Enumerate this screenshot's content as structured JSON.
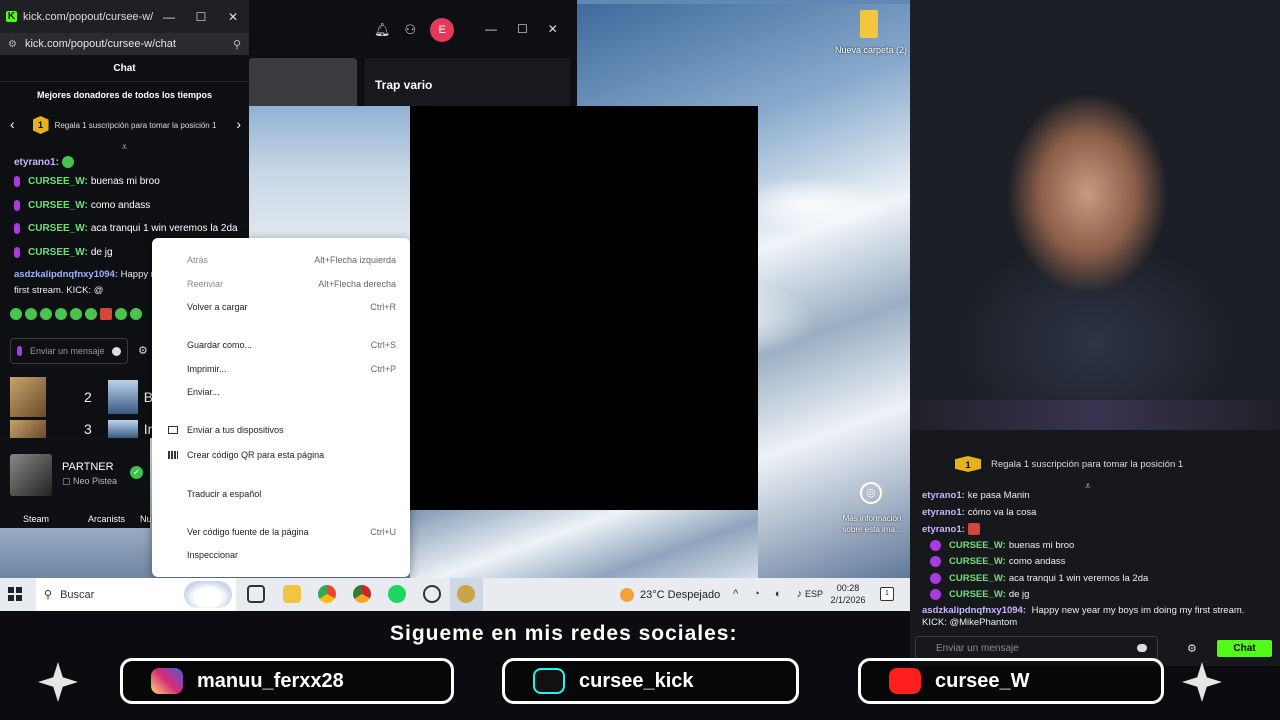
{
  "chat_window": {
    "title": "kick.com/popout/cursee-w/chat...",
    "url": "kick.com/popout/cursee-w/chat",
    "min": "—",
    "max": "☐",
    "close": "✕",
    "header": "Chat",
    "donors_title": "Mejores donadores de todos los tiempos",
    "gift_badge": "1",
    "gift_text": "Regala 1 suscripción para tomar la posición 1",
    "messages": [
      {
        "user": "etyrano1:",
        "text": ""
      },
      {
        "user": "CURSEE_W:",
        "text": "buenas mi broo"
      },
      {
        "user": "CURSEE_W:",
        "text": "como andass"
      },
      {
        "user": "CURSEE_W:",
        "text": "aca tranqui 1 win veremos la 2da"
      },
      {
        "user": "CURSEE_W:",
        "text": "de jg"
      }
    ],
    "long_message_user": "asdzkalipdnqfnxy1094:",
    "long_message_text": "Happy n... im doing my first stream. KICK: @",
    "input_placeholder": "Enviar un mensaje",
    "leaderboard": [
      {
        "rank": "2",
        "name": "B"
      },
      {
        "rank": "3",
        "name": "In"
      }
    ]
  },
  "partner": {
    "name": "PARTNER",
    "sub": "Neo Pistea"
  },
  "desktop_labels": [
    "Steam",
    "Arcanists",
    "Nu"
  ],
  "app": {
    "avatar_letter": "E",
    "card_title": "Trap vario",
    "min": "—",
    "max": "☐",
    "close": "✕"
  },
  "desktop": {
    "folder_label": "Nueva carpeta (2)",
    "info_label": "Más información sobre esta ima..."
  },
  "context_menu": {
    "items": [
      {
        "label": "Atrás",
        "shortcut": "Alt+Flecha izquierda",
        "disabled": true
      },
      {
        "label": "Reenviar",
        "shortcut": "Alt+Flecha derecha",
        "disabled": true
      },
      {
        "label": "Volver a cargar",
        "shortcut": "Ctrl+R",
        "disabled": false
      },
      {
        "label": "Guardar como...",
        "shortcut": "Ctrl+S",
        "disabled": false
      },
      {
        "label": "Imprimir...",
        "shortcut": "Ctrl+P",
        "disabled": false
      },
      {
        "label": "Enviar...",
        "shortcut": "",
        "disabled": false
      },
      {
        "label": "Enviar a tus dispositivos",
        "shortcut": "",
        "disabled": false
      },
      {
        "label": "Crear código QR para esta página",
        "shortcut": "",
        "disabled": false
      },
      {
        "label": "Traducir a español",
        "shortcut": "",
        "disabled": false
      },
      {
        "label": "Ver código fuente de la página",
        "shortcut": "Ctrl+U",
        "disabled": false
      },
      {
        "label": "Inspeccionar",
        "shortcut": "",
        "disabled": false
      }
    ]
  },
  "taskbar": {
    "search_label": "Buscar",
    "weather": "23°C  Despejado",
    "language": "ESP",
    "time": "00:28",
    "date": "2/1/2026",
    "notif_count": "1"
  },
  "stream_chat": {
    "gift_badge": "1",
    "gift_text": "Regala 1 suscripción para tomar la posición 1",
    "messages": [
      {
        "user": "etyrano1:",
        "text": "ke pasa Manin",
        "badge": false
      },
      {
        "user": "etyrano1:",
        "text": "cómo va la cosa",
        "badge": false
      },
      {
        "user": "etyrano1:",
        "text": "",
        "badge": false
      },
      {
        "user": "CURSEE_W:",
        "text": "buenas mi broo",
        "badge": true
      },
      {
        "user": "CURSEE_W:",
        "text": "como andass",
        "badge": true
      },
      {
        "user": "CURSEE_W:",
        "text": "aca tranqui 1 win veremos la 2da",
        "badge": true
      },
      {
        "user": "CURSEE_W:",
        "text": "de jg",
        "badge": true
      }
    ],
    "long_user": "asdzkalipdnqfnxy1094:",
    "long_text": "Happy new year my boys im doing my first stream. KICK: @MikePhantom",
    "input_placeholder": "Enviar un mensaje",
    "chat_button": "Chat"
  },
  "overlay": {
    "title": "Sigueme en mis redes sociales:",
    "socials": [
      {
        "icon": "instagram-icon",
        "handle": "manuu_ferxx28",
        "color": "#d6249f"
      },
      {
        "icon": "tiktok-icon",
        "handle": "cursee_kick",
        "color": "#111111"
      },
      {
        "icon": "youtube-icon",
        "handle": "cursee_W",
        "color": "#ff1f1f"
      }
    ]
  },
  "colors": {
    "kick_green": "#53fc18",
    "badge_purple": "#a93be0",
    "gold": "#e5b21c"
  }
}
